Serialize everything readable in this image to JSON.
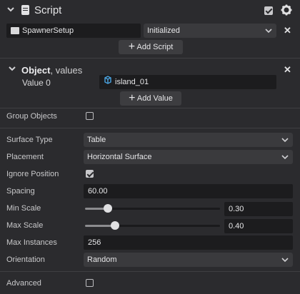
{
  "header": {
    "title": "Script"
  },
  "script_row": {
    "name": "SpawnerSetup",
    "event": "Initialized"
  },
  "add_script_label": "Add Script",
  "object_section": {
    "title": "Object",
    "subtitle": ", values",
    "value_label": "Value 0",
    "value": "island_01",
    "add_value_label": "Add Value"
  },
  "fields": {
    "group_objects": {
      "label": "Group Objects",
      "checked": false
    },
    "surface_type": {
      "label": "Surface Type",
      "value": "Table"
    },
    "placement": {
      "label": "Placement",
      "value": "Horizontal Surface"
    },
    "ignore_position": {
      "label": "Ignore Position",
      "checked": true
    },
    "spacing": {
      "label": "Spacing",
      "value": "60.00"
    },
    "min_scale": {
      "label": "Min Scale",
      "value": "0.30",
      "slider_fraction": 0.17
    },
    "max_scale": {
      "label": "Max Scale",
      "value": "0.40",
      "slider_fraction": 0.22
    },
    "max_instances": {
      "label": "Max Instances",
      "value": "256"
    },
    "orientation": {
      "label": "Orientation",
      "value": "Random"
    },
    "advanced": {
      "label": "Advanced",
      "checked": false
    }
  },
  "icons": {
    "collapse": "chevron-down-icon",
    "script": "script-icon",
    "enabled": "checkbox-icon",
    "settings": "gear-icon",
    "remove": "close-icon",
    "add": "plus-icon",
    "object": "cube-icon",
    "dropdown": "chevron-down-icon"
  },
  "colors": {
    "background": "#2b2b2e",
    "field": "#1c1c1e",
    "select": "#3a3a3d",
    "cube": "#4aa3e0"
  }
}
